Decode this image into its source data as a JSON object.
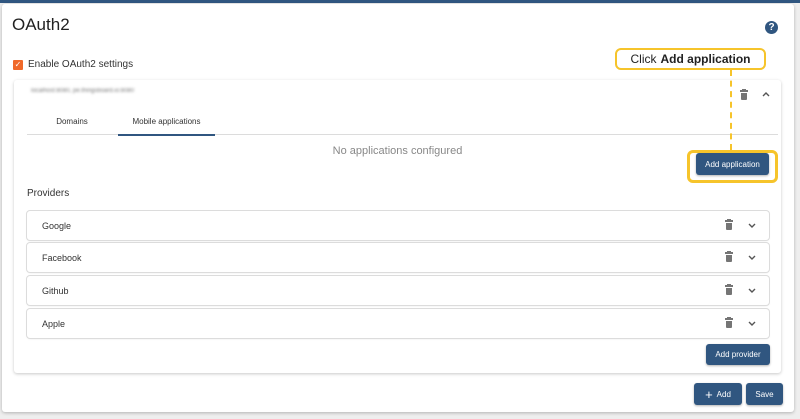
{
  "page": {
    "title": "OAuth2",
    "help_icon": "?"
  },
  "enable": {
    "label": "Enable OAuth2 settings",
    "checked": true,
    "check_glyph": "✓"
  },
  "domain": {
    "name": "localhost:8080, pe.thingsboard.io:8080",
    "tabs": [
      {
        "label": "Domains",
        "active": false
      },
      {
        "label": "Mobile applications",
        "active": true
      }
    ],
    "empty_message": "No applications configured",
    "add_application_label": "Add application"
  },
  "tooltip": {
    "prefix": "Click",
    "action": "Add application"
  },
  "providers": {
    "title": "Providers",
    "items": [
      {
        "name": "Google"
      },
      {
        "name": "Facebook"
      },
      {
        "name": "Github"
      },
      {
        "name": "Apple"
      }
    ],
    "add_provider_label": "Add provider"
  },
  "footer": {
    "add_label": "Add",
    "add_glyph": "+",
    "save_label": "Save"
  },
  "colors": {
    "primary": "#305680",
    "accent": "#f0692a",
    "highlight": "#f6c42b"
  }
}
